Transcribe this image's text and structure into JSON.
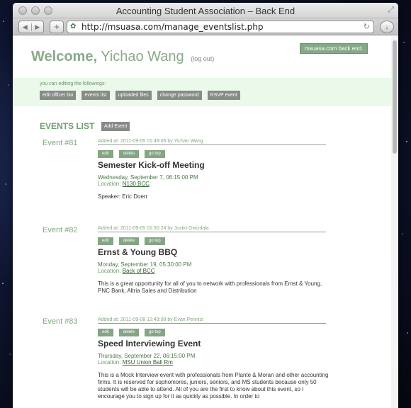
{
  "window": {
    "title": "Accounting Student Association – Back End",
    "url": "http://msuasa.com/manage_eventslist.php"
  },
  "header": {
    "welcome": "Welcome,",
    "user": "Yichao Wang",
    "logout": "(log out)",
    "backend_button": "msuasa.com back end."
  },
  "editbar": {
    "label": "you can editing the followings:",
    "links": [
      "edit officer bio",
      "events list",
      "uploaded files",
      "change password",
      "RSVP event"
    ]
  },
  "events_section": {
    "title": "EVENTS LIST",
    "add_button": "Add Event"
  },
  "actions": {
    "edit": "edit",
    "delete": "delete",
    "go_top": "go top"
  },
  "events": [
    {
      "number": "Event #81",
      "added": "Added at: 2011-09-05 01:49:06 by Yichao Wang",
      "title": "Semester Kick-off Meeting",
      "date": "Wednesday, September 7, 06:15:00 PM",
      "location_label": "Location:",
      "location": "N130 BCC",
      "description": "Speaker: Eric Doerr"
    },
    {
      "number": "Event #82",
      "added": "Added at: 2011-09-05 01:50:24 by Justin Gwizdala",
      "title": "Ernst & Young BBQ",
      "date": "Monday, September 19, 05:30:00 PM",
      "location_label": "Location:",
      "location": "Back of BCC",
      "description": "This is a great opportunity for all of you to network with professionals from Ernst & Young, PNC Bank, Altria Sales and Distribution"
    },
    {
      "number": "Event #83",
      "added": "Added at: 2011-09-08 12:49:08 by Evan Pennisi",
      "title": "Speed Interviewing Event",
      "date": "Thursday, September 22, 06:15:00 PM",
      "location_label": "Location:",
      "location": "MSU Union Ball Rm",
      "description": "This is a Mock Interview event with professionals from Plante & Moran and other accounting firms. It is reserved for sophomores, juniors, seniors, and MS students because only 50 students will be able to attend. All of you are the first to know about this event, so I encourage you to sign up for it as quickly as possible. In order to"
    }
  ]
}
